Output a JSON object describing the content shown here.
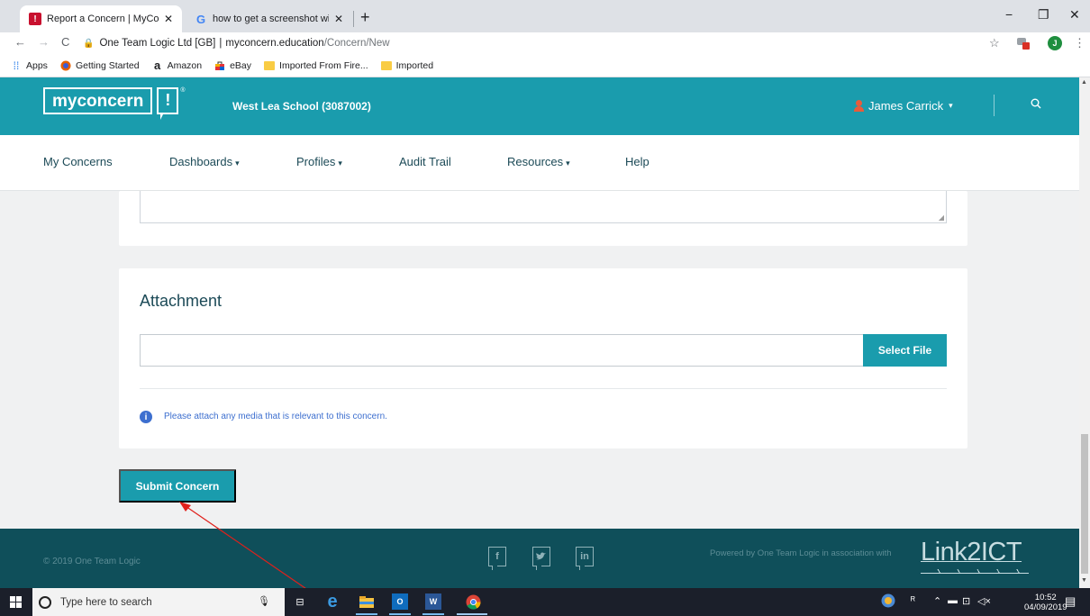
{
  "browser": {
    "tabs": [
      {
        "title": "Report a Concern | MyConcern",
        "active": true
      },
      {
        "title": "how to get a screenshot window",
        "active": false
      }
    ],
    "new_tab": "+",
    "window_controls": {
      "minimize": "−",
      "restore": "❐",
      "close": "✕"
    },
    "nav": {
      "back": "←",
      "forward": "→",
      "reload": "C"
    },
    "address": {
      "site_identity": "One Team Logic Ltd [GB]",
      "separator": "|",
      "host": "myconcern.education",
      "path": "/Concern/New"
    },
    "profile_initial": "J",
    "bookmarks": [
      {
        "label": "Apps",
        "icon": "apps-grid-icon"
      },
      {
        "label": "Getting Started",
        "icon": "firefox-icon"
      },
      {
        "label": "Amazon",
        "icon": "amazon-icon"
      },
      {
        "label": "eBay",
        "icon": "ebay-bag-icon"
      },
      {
        "label": "Imported From Fire...",
        "icon": "folder-icon"
      },
      {
        "label": "Imported",
        "icon": "folder-icon"
      }
    ]
  },
  "app": {
    "logo_text": "myconcern",
    "logo_mark": "!",
    "logo_reg": "®",
    "school": "West Lea School (3087002)",
    "user": "James Carrick",
    "nav": [
      {
        "label": "My Concerns",
        "dropdown": false
      },
      {
        "label": "Dashboards",
        "dropdown": true
      },
      {
        "label": "Profiles",
        "dropdown": true
      },
      {
        "label": "Audit Trail",
        "dropdown": false
      },
      {
        "label": "Resources",
        "dropdown": true
      },
      {
        "label": "Help",
        "dropdown": false
      }
    ],
    "dropdown_caret": "▾",
    "attachment": {
      "heading": "Attachment",
      "select_button": "Select File",
      "info_icon": "i",
      "info_text": "Please attach any media that is relevant to this concern."
    },
    "submit_button": "Submit Concern",
    "footer": {
      "copyright": "© 2019 One Team Logic",
      "social": [
        "f",
        "t",
        "in"
      ],
      "powered_by": "Powered by One Team Logic in association with",
      "partner": "Link2ICT"
    },
    "colors": {
      "brand": "#1a9cad",
      "footer": "#0f4f5a",
      "info": "#3d6fcf",
      "annotation_arrow": "#e0201b"
    }
  },
  "taskbar": {
    "search_placeholder": "Type here to search",
    "time": "10:52",
    "date": "04/09/2019",
    "apps": [
      "task-view-icon",
      "edge-icon",
      "file-explorer-icon",
      "outlook-icon",
      "word-icon",
      "chrome-icon"
    ]
  }
}
